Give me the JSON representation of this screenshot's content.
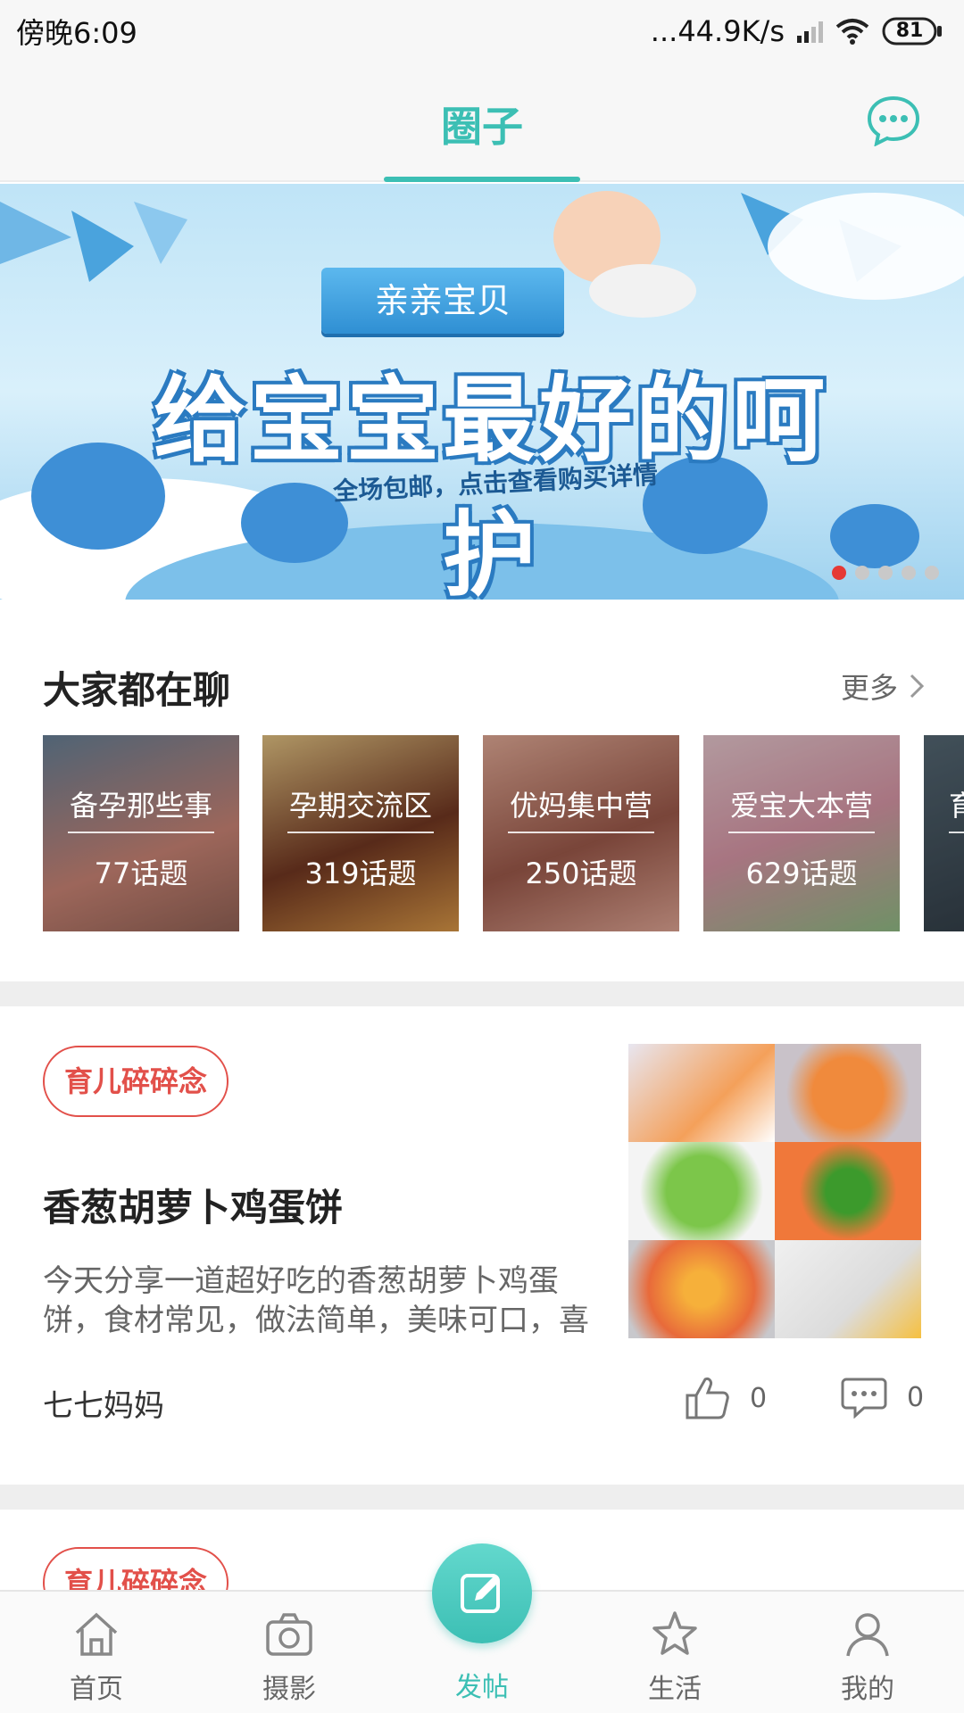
{
  "status_bar": {
    "time": "傍晚6:09",
    "net_speed": "...44.9K/s",
    "battery": "81"
  },
  "header": {
    "title": "圈子",
    "chat_icon": "chat-bubble-icon",
    "accent_color": "#3cbfb4"
  },
  "banner": {
    "tag": "亲亲宝贝",
    "title": "给宝宝最好的呵护",
    "subtitle": "全场包邮，点击查看购买详情",
    "slide_count": 5,
    "active_slide": 1
  },
  "hot_section": {
    "title": "大家都在聊",
    "more_label": "更多",
    "cards": [
      {
        "name": "备孕那些事",
        "count": "77话题"
      },
      {
        "name": "孕期交流区",
        "count": "319话题"
      },
      {
        "name": "优妈集中营",
        "count": "250话题"
      },
      {
        "name": "爱宝大本营",
        "count": "629话题"
      },
      {
        "name": "育",
        "count": ""
      }
    ]
  },
  "post": {
    "tag": "育儿碎碎念",
    "title": "香葱胡萝卜鸡蛋饼",
    "description": "今天分享一道超好吃的香葱胡萝卜鸡蛋饼，食材常见，做法简单，美味可口，喜",
    "author": "七七妈妈",
    "likes": "0",
    "comments": "0"
  },
  "post2": {
    "tag": "育儿碎碎念"
  },
  "bottom_nav": {
    "items": [
      {
        "label": "首页",
        "icon": "home-icon"
      },
      {
        "label": "摄影",
        "icon": "camera-icon"
      },
      {
        "label": "发帖",
        "icon": "edit-icon"
      },
      {
        "label": "生活",
        "icon": "star-icon"
      },
      {
        "label": "我的",
        "icon": "user-icon"
      }
    ]
  }
}
